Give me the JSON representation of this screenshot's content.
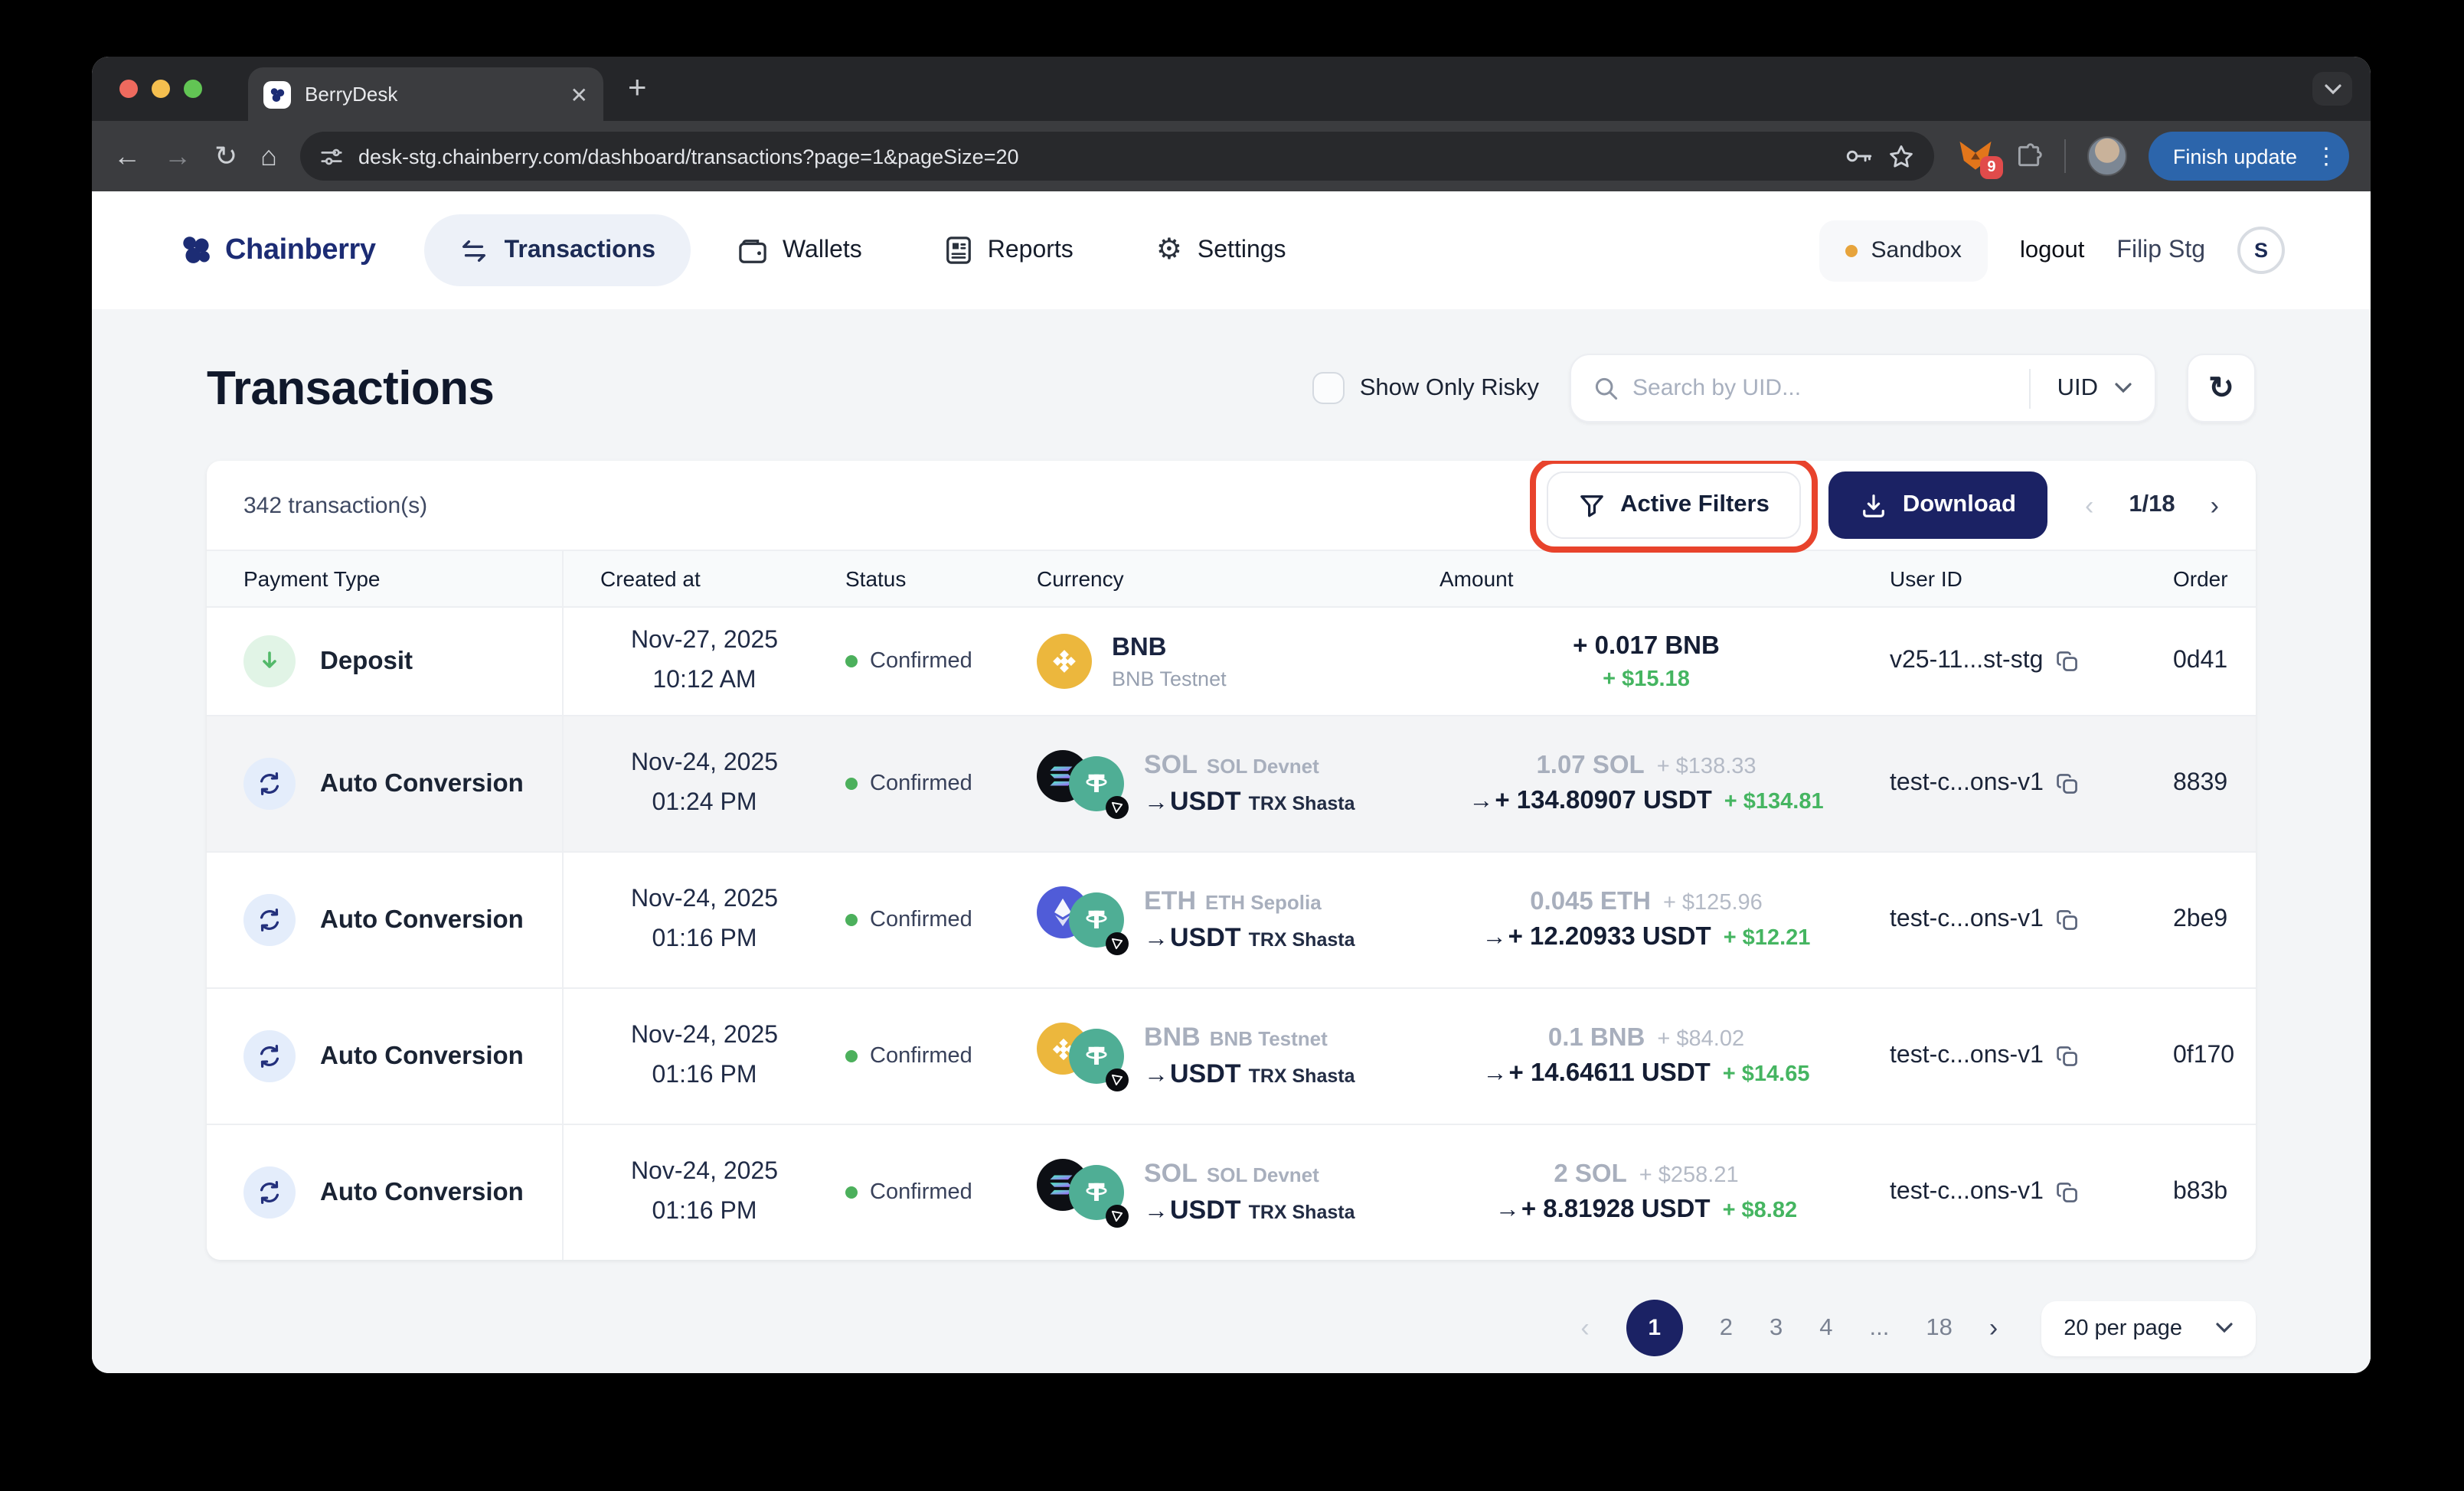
{
  "browser": {
    "tab_title": "BerryDesk",
    "url": "desk-stg.chainberry.com/dashboard/transactions?page=1&pageSize=20",
    "extension_badge": "9",
    "update_label": "Finish update"
  },
  "app_header": {
    "brand": "Chainberry",
    "nav": [
      {
        "label": "Transactions"
      },
      {
        "label": "Wallets"
      },
      {
        "label": "Reports"
      },
      {
        "label": "Settings"
      }
    ],
    "environment": "Sandbox",
    "logout_label": "logout",
    "user_name": "Filip Stg",
    "avatar_initial": "S"
  },
  "page": {
    "title": "Transactions",
    "risky_label": "Show Only Risky",
    "search_placeholder": "Search by UID...",
    "search_filter": "UID",
    "count": "342 transaction(s)",
    "active_filters_label": "Active Filters",
    "download_label": "Download",
    "page_indicator": "1/18"
  },
  "table": {
    "headers": {
      "payment": "Payment Type",
      "created": "Created at",
      "status": "Status",
      "currency": "Currency",
      "amount": "Amount",
      "user": "User ID",
      "order": "Order"
    },
    "rows": [
      {
        "type": "Deposit",
        "date": "Nov-27, 2025",
        "time": "10:12 AM",
        "status": "Confirmed",
        "coin": "BNB",
        "network": "BNB Testnet",
        "amount": "+ 0.017 BNB",
        "fiat": "+ $15.18",
        "user_id": "v25-11...st-stg",
        "order": "0d41"
      },
      {
        "type": "Auto Conversion",
        "date": "Nov-24, 2025",
        "time": "01:24 PM",
        "status": "Confirmed",
        "coin": "SOL",
        "network": "SOL Devnet",
        "to_coin": "USDT",
        "to_network": "TRX Shasta",
        "from_amount": "1.07 SOL",
        "from_fiat": "+ $138.33",
        "to_amount": "+ 134.80907 USDT",
        "to_fiat": "+ $134.81",
        "user_id": "test-c...ons-v1",
        "order": "8839"
      },
      {
        "type": "Auto Conversion",
        "date": "Nov-24, 2025",
        "time": "01:16 PM",
        "status": "Confirmed",
        "coin": "ETH",
        "network": "ETH Sepolia",
        "to_coin": "USDT",
        "to_network": "TRX Shasta",
        "from_amount": "0.045 ETH",
        "from_fiat": "+ $125.96",
        "to_amount": "+ 12.20933 USDT",
        "to_fiat": "+ $12.21",
        "user_id": "test-c...ons-v1",
        "order": "2be9"
      },
      {
        "type": "Auto Conversion",
        "date": "Nov-24, 2025",
        "time": "01:16 PM",
        "status": "Confirmed",
        "coin": "BNB",
        "network": "BNB Testnet",
        "to_coin": "USDT",
        "to_network": "TRX Shasta",
        "from_amount": "0.1 BNB",
        "from_fiat": "+ $84.02",
        "to_amount": "+ 14.64611 USDT",
        "to_fiat": "+ $14.65",
        "user_id": "test-c...ons-v1",
        "order": "0f170"
      },
      {
        "type": "Auto Conversion",
        "date": "Nov-24, 2025",
        "time": "01:16 PM",
        "status": "Confirmed",
        "coin": "SOL",
        "network": "SOL Devnet",
        "to_coin": "USDT",
        "to_network": "TRX Shasta",
        "from_amount": "2 SOL",
        "from_fiat": "+ $258.21",
        "to_amount": "+ 8.81928 USDT",
        "to_fiat": "+ $8.82",
        "user_id": "test-c...ons-v1",
        "order": "b83b"
      }
    ]
  },
  "pagination": {
    "pages": [
      "1",
      "2",
      "3",
      "4",
      "...",
      "18"
    ],
    "current": "1",
    "per_page": "20 per page"
  },
  "colors": {
    "brand_navy": "#1b2264",
    "annotation_red": "#e8432c",
    "success_green": "#45b561",
    "sandbox_orange": "#e7a43c",
    "bnb_gold": "#ecb73d",
    "usdt_teal": "#4fae95",
    "eth_indigo": "#505cd8"
  }
}
